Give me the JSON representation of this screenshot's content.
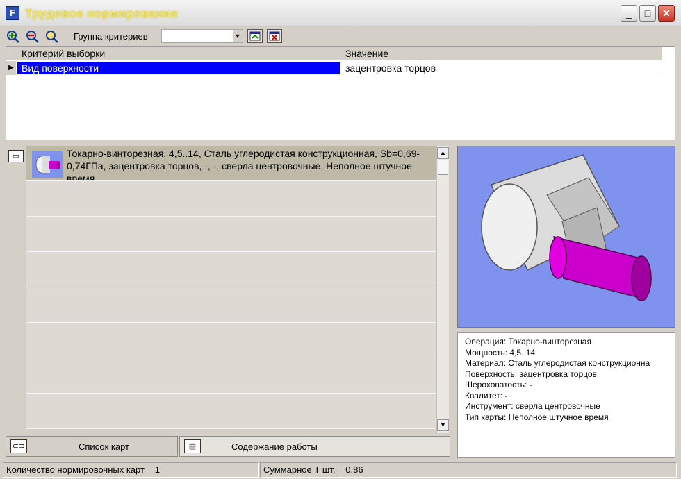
{
  "window": {
    "title": "Трудовое нормирование",
    "icon_letter": "F",
    "minimize": "_",
    "maximize": "□",
    "close": "✕"
  },
  "toolbar": {
    "group_label": "Группа критериев",
    "group_value": ""
  },
  "criteria": {
    "col_criterion": "Критерий выборки",
    "col_value": "Значение",
    "rows": [
      {
        "criterion": "Вид поверхности",
        "value": "зацентровка торцов"
      }
    ]
  },
  "cards": {
    "items": [
      {
        "text": "Токарно-винторезная, 4,5..14, Сталь углеродистая конструкционная, Sb=0,69-0,74ГПа, зацентровка торцов, -, -, сверла центровочные, Неполное штучное время"
      },
      {
        "text": ""
      },
      {
        "text": ""
      },
      {
        "text": ""
      },
      {
        "text": ""
      },
      {
        "text": ""
      },
      {
        "text": ""
      },
      {
        "text": ""
      }
    ]
  },
  "details": {
    "operation": "Операция: Токарно-винторезная",
    "power": "Мощность: 4,5..14",
    "material": "Материал: Сталь углеродистая конструкционна",
    "surface": "Поверхность: зацентровка торцов",
    "roughness": "Шероховатость: -",
    "grade": "Квалитет: -",
    "tool": "Инструмент: сверла центровочные",
    "card_type": "Тип карты: Неполное штучное время"
  },
  "tabs": {
    "card_list": "Список карт",
    "work_content": "Содержание работы"
  },
  "status": {
    "count": "Количество нормировочных карт = 1",
    "total": "Суммарное Т шт. = 0.86"
  },
  "colors": {
    "selection": "#0000ff",
    "preview_bg": "#7f92ee",
    "part_body": "#e0e0e0",
    "part_pin": "#cc00cc"
  }
}
